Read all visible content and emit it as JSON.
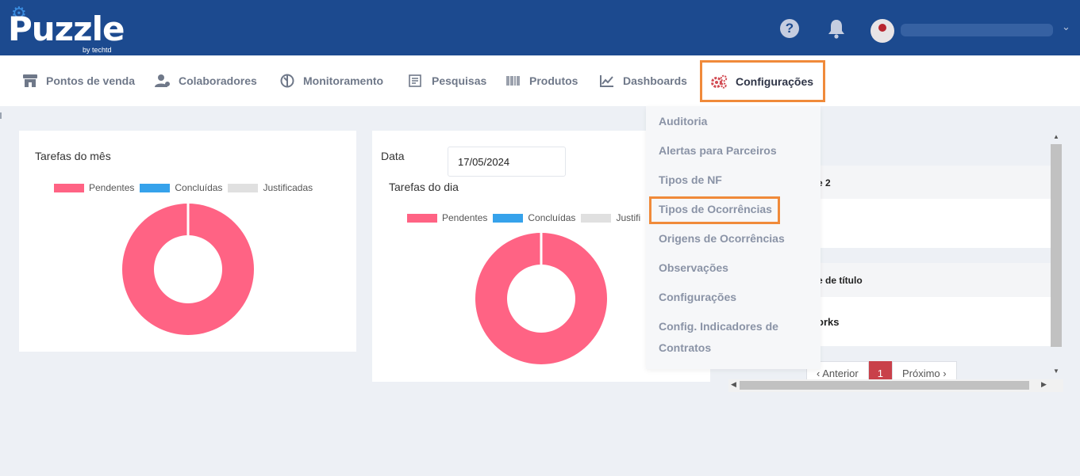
{
  "header": {
    "logo_text": "Puzzle",
    "logo_sub": "by techtd",
    "help_icon": "?",
    "user_chevron": "⌄"
  },
  "nav": {
    "items": [
      {
        "label": "Pontos de venda",
        "icon": "store-icon"
      },
      {
        "label": "Colaboradores",
        "icon": "users-icon"
      },
      {
        "label": "Monitoramento",
        "icon": "monitor-icon"
      },
      {
        "label": "Pesquisas",
        "icon": "survey-icon"
      },
      {
        "label": "Produtos",
        "icon": "barcode-icon"
      },
      {
        "label": "Dashboards",
        "icon": "chart-icon"
      }
    ],
    "active": {
      "label": "Configurações",
      "icon": "gears-icon"
    }
  },
  "dropdown": {
    "items": [
      "Auditoria",
      "Alertas para Parceiros",
      "Tipos de NF",
      "Tipos de Ocorrências",
      "Origens de Ocorrências",
      "Observações",
      "Configurações",
      "Config. Indicadores de",
      "Contratos"
    ],
    "highlighted_index": 3
  },
  "month_card": {
    "title": "Tarefas do mês",
    "legend": [
      "Pendentes",
      "Concluídas",
      "Justificadas"
    ]
  },
  "day_card": {
    "date_label": "Data",
    "date_value": "17/05/2024",
    "title": "Tarefas do dia",
    "legend": [
      "Pendentes",
      "Concluídas",
      "Justifi"
    ]
  },
  "table": {
    "fragments": [
      "e 2",
      "e de título",
      "orks"
    ]
  },
  "pager": {
    "prev": "‹ Anterior",
    "current": "1",
    "next": "Próximo ›"
  },
  "colors": {
    "header": "#1c4a8f",
    "pending": "#ff6384",
    "done": "#36a2eb",
    "justified": "#e0e0e0",
    "highlight": "#f08a3a"
  },
  "chart_data": [
    {
      "type": "pie",
      "title": "Tarefas do mês",
      "categories": [
        "Pendentes",
        "Concluídas",
        "Justificadas"
      ],
      "values": [
        100,
        0,
        0
      ]
    },
    {
      "type": "pie",
      "title": "Tarefas do dia",
      "categories": [
        "Pendentes",
        "Concluídas",
        "Justificadas"
      ],
      "values": [
        100,
        0,
        0
      ]
    }
  ]
}
